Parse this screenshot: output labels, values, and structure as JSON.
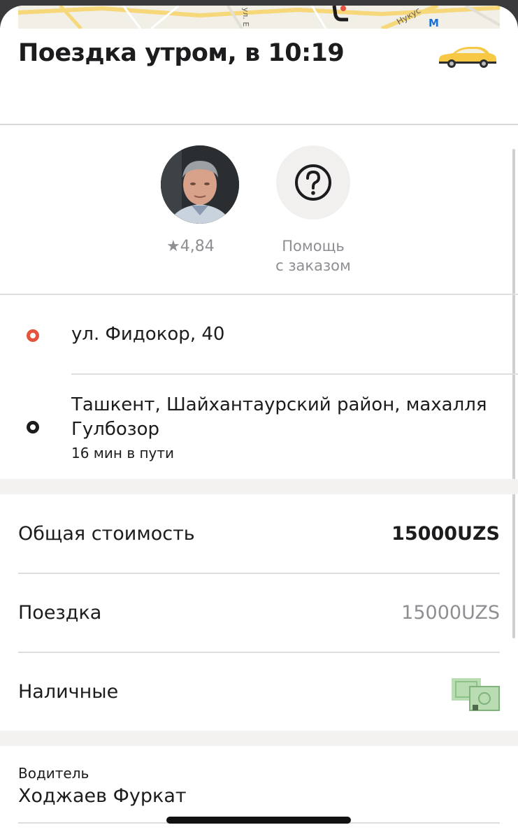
{
  "map": {
    "street_1": "Нукус",
    "street_2": "ул. Е",
    "metro_icon": "metro-icon"
  },
  "header": {
    "title": "Поездка утром, в 10:19",
    "icon": "taxi-car-icon"
  },
  "driver_card": {
    "rating": "★4,84",
    "avatar_icon": "driver-avatar"
  },
  "help": {
    "label_line1": "Помощь",
    "label_line2": "с заказом",
    "icon": "question-circle-icon"
  },
  "route": {
    "from": {
      "address": "ул. Фидокор, 40",
      "color": "#e5533d"
    },
    "to": {
      "address_line1": "Ташкент, Шайхантаурский район, махалля",
      "address_line2": "Гулбозор",
      "duration": "16 мин в пути",
      "color": "#1c1c1e"
    }
  },
  "cost": {
    "total_label": "Общая стоимость",
    "total_value": "15000UZS",
    "ride_label": "Поездка",
    "ride_value": "15000UZS",
    "payment_label": "Наличные",
    "payment_icon": "cash-icon"
  },
  "driver": {
    "caption": "Водитель",
    "name": "Ходжаев Фуркат"
  },
  "colors": {
    "accent_yellow": "#f7c844",
    "muted": "#8e8e93",
    "divider": "#dedede"
  }
}
